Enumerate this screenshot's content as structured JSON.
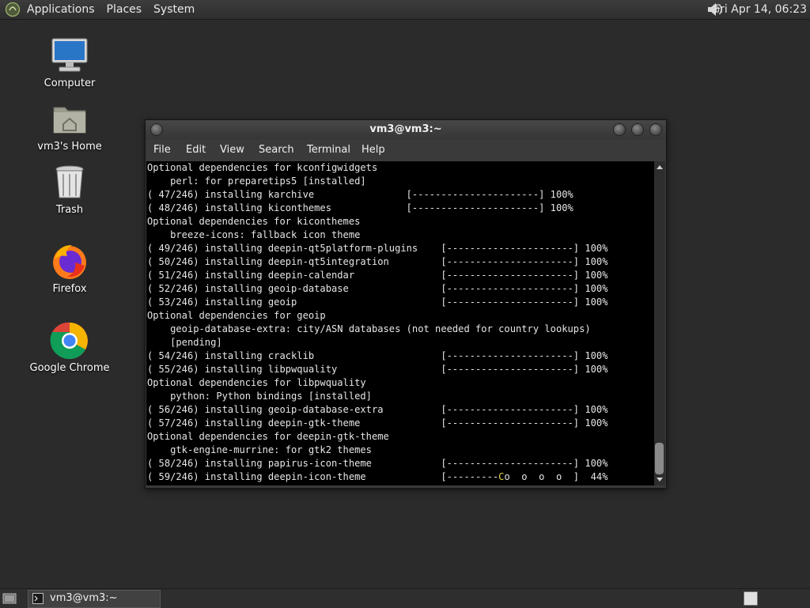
{
  "top_panel": {
    "menu": [
      "Applications",
      "Places",
      "System"
    ],
    "clock": "Fri Apr 14, 06:23",
    "icons": {
      "logo": "mate-logo-icon",
      "volume": "volume-icon"
    }
  },
  "desktop": {
    "icons": [
      {
        "label": "Computer",
        "icon": "computer-icon"
      },
      {
        "label": "vm3's Home",
        "icon": "home-folder-icon"
      },
      {
        "label": "Trash",
        "icon": "trash-icon"
      },
      {
        "label": "Firefox",
        "icon": "firefox-icon"
      },
      {
        "label": "Google Chrome",
        "icon": "chrome-icon"
      }
    ]
  },
  "window": {
    "title": "vm3@vm3:~",
    "menu": [
      "File",
      "Edit",
      "View",
      "Search",
      "Terminal",
      "Help"
    ],
    "terminal_lines": [
      "Optional dependencies for kconfigwidgets",
      "    perl: for preparetips5 [installed]",
      "( 47/246) installing karchive                [----------------------] 100%",
      "( 48/246) installing kiconthemes             [----------------------] 100%",
      "Optional dependencies for kiconthemes",
      "    breeze-icons: fallback icon theme",
      "( 49/246) installing deepin-qt5platform-plugins    [----------------------] 100%",
      "( 50/246) installing deepin-qt5integration         [----------------------] 100%",
      "( 51/246) installing deepin-calendar               [----------------------] 100%",
      "( 52/246) installing geoip-database                [----------------------] 100%",
      "( 53/246) installing geoip                         [----------------------] 100%",
      "Optional dependencies for geoip",
      "    geoip-database-extra: city/ASN databases (not needed for country lookups)",
      "    [pending]",
      "( 54/246) installing cracklib                      [----------------------] 100%",
      "( 55/246) installing libpwquality                  [----------------------] 100%",
      "Optional dependencies for libpwquality",
      "    python: Python bindings [installed]",
      "( 56/246) installing geoip-database-extra          [----------------------] 100%",
      "( 57/246) installing deepin-gtk-theme              [----------------------] 100%",
      "Optional dependencies for deepin-gtk-theme",
      "    gtk-engine-murrine: for gtk2 themes",
      "( 58/246) installing papirus-icon-theme            [----------------------] 100%"
    ],
    "current_line": {
      "prefix": "( 59/246) installing deepin-icon-theme             [---------",
      "pacman": "C",
      "suffix": "o  o  o  o  ]  44%"
    },
    "colors": {
      "terminal_bg": "#000000",
      "terminal_fg": "#e6e6e6",
      "pacman": "#e6d24a"
    }
  },
  "bottom_panel": {
    "task_label": "vm3@vm3:~",
    "icons": {
      "show_desktop": "show-desktop-icon",
      "terminal": "terminal-icon",
      "workspace": "workspace-switcher"
    }
  }
}
